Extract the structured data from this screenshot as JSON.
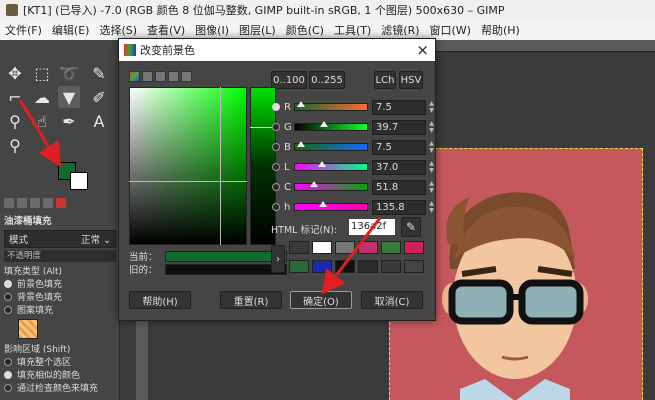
{
  "window": {
    "title": "[KT1] (已导入) -7.0 (RGB 颜色 8 位伽马整数, GIMP built-in sRGB, 1 个图层) 500x630 – GIMP"
  },
  "menu": [
    "文件(F)",
    "编辑(E)",
    "选择(S)",
    "查看(V)",
    "图像(I)",
    "图层(L)",
    "颜色(C)",
    "工具(T)",
    "滤镜(R)",
    "窗口(W)",
    "帮助(H)"
  ],
  "tool_options": {
    "title": "油漆桶填充",
    "mode_label": "模式",
    "mode_value": "正常",
    "opacity_label": "不透明度",
    "fill_type_label": "填充类型 (Alt)",
    "fill_types": [
      "前景色填充",
      "背景色填充",
      "图案填充"
    ],
    "affected_label": "影响区域 (Shift)",
    "affected": [
      "填充整个选区",
      "填充相似的颜色",
      "通过检查颜色来填充"
    ]
  },
  "dialog": {
    "title": "改变前景色",
    "close": "×",
    "range_buttons": [
      "0..100",
      "0..255"
    ],
    "model_buttons": [
      "LCh",
      "HSV"
    ],
    "channels": [
      {
        "label": "R",
        "value": "7.5",
        "pct": 7.5,
        "gradient": [
          "#136a2f",
          "#ff6a2f"
        ],
        "selected": true
      },
      {
        "label": "G",
        "value": "39.7",
        "pct": 39.7,
        "gradient": [
          "#000000",
          "#16ff2f"
        ],
        "selected": false
      },
      {
        "label": "B",
        "value": "7.5",
        "pct": 7.5,
        "gradient": [
          "#136a00",
          "#136aff"
        ],
        "selected": false
      },
      {
        "label": "L",
        "value": "37.0",
        "pct": 37.0,
        "gradient": [
          "#ff00ff",
          "#00ff88"
        ],
        "selected": false
      },
      {
        "label": "C",
        "value": "51.8",
        "pct": 25.0,
        "gradient": [
          "#ff00ff",
          "#00aa00"
        ],
        "selected": false
      },
      {
        "label": "h",
        "value": "135.8",
        "pct": 37.7,
        "gradient": [
          "#ff00ff",
          "#ff00aa"
        ],
        "selected": false
      }
    ],
    "html_label": "HTML 标记(N):",
    "hex_value": "136a2f",
    "current_label": "当前：",
    "old_label": "旧的：",
    "history_colors": [
      "#3a3a3a",
      "#ffffff",
      "#777777",
      "#c0336f",
      "#3a7a3a",
      "#cc2255",
      "#2a6a3a",
      "#1a2ab0",
      "#111111",
      "#2a2a2a",
      "#3a3a3a",
      "#444444"
    ],
    "buttons": {
      "help": "帮助(H)",
      "reset": "重置(R)",
      "ok": "确定(O)",
      "cancel": "取消(C)"
    }
  },
  "colors": {
    "foreground": "#136a2f",
    "background": "#ffffff",
    "image_bg": "#c5585d",
    "annotation": "#e02020"
  }
}
